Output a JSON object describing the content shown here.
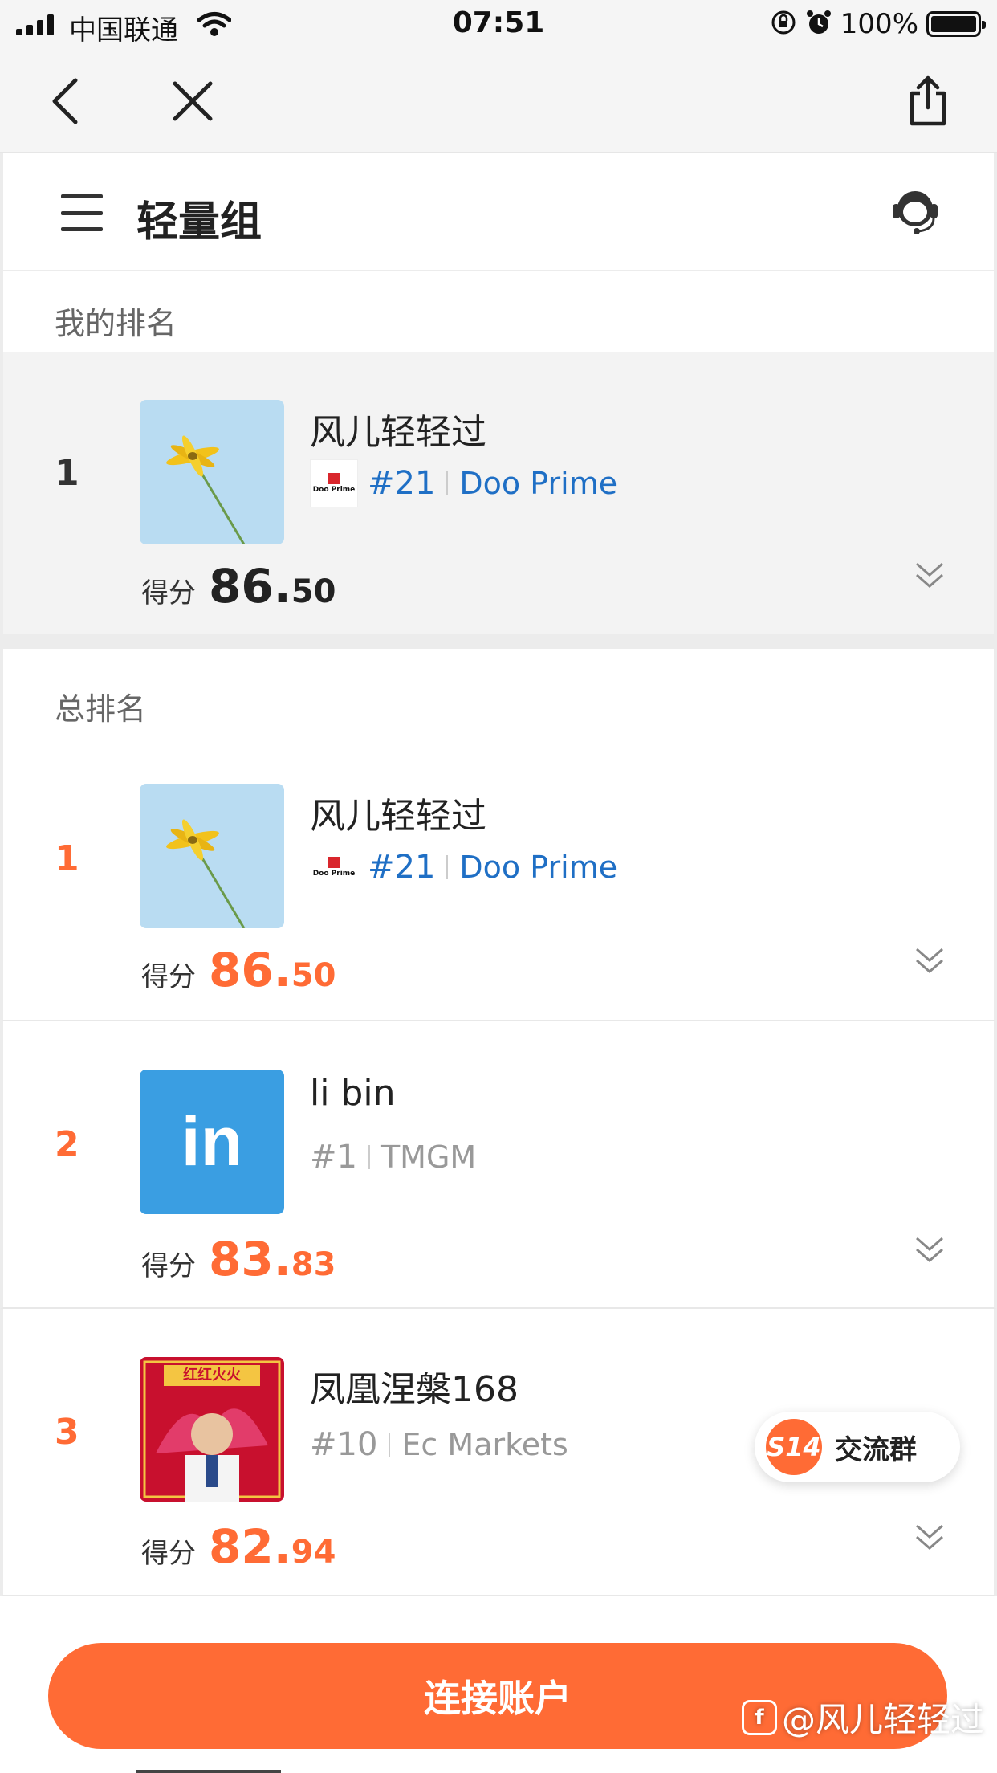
{
  "status_bar": {
    "carrier": "中国联通",
    "time": "07:51",
    "battery": "100%"
  },
  "header": {
    "title": "轻量组"
  },
  "my_rank": {
    "section_label": "我的排名",
    "entry": {
      "rank": "1",
      "name": "风儿轻轻过",
      "account_rank": "#21",
      "broker": "Doo Prime",
      "broker_logo_text": "Doo Prime",
      "score_label": "得分",
      "score_int": "86.",
      "score_dec": "50"
    }
  },
  "overall": {
    "section_label": "总排名",
    "entries": [
      {
        "rank": "1",
        "name": "风儿轻轻过",
        "account_rank": "#21",
        "broker": "Doo Prime",
        "broker_logo_text": "Doo Prime",
        "score_label": "得分",
        "score_int": "86.",
        "score_dec": "50"
      },
      {
        "rank": "2",
        "name": "li bin",
        "account_rank": "#1",
        "broker": "TMGM",
        "avatar_text": "in",
        "score_label": "得分",
        "score_int": "83.",
        "score_dec": "83"
      },
      {
        "rank": "3",
        "name": "凤凰涅槃168",
        "account_rank": "#10",
        "broker": "Ec Markets",
        "avatar_banner": "红红火火",
        "score_label": "得分",
        "score_int": "82.",
        "score_dec": "94"
      }
    ]
  },
  "chat": {
    "badge": "S14",
    "label": "交流群"
  },
  "bottom": {
    "connect_label": "连接账户"
  },
  "watermark": "@风儿轻轻过",
  "colors": {
    "accent": "#ff6b35",
    "link_blue": "#1f6fc5",
    "linkedin_blue": "#3a9ee2"
  }
}
